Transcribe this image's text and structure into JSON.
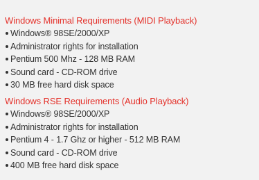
{
  "sections": [
    {
      "heading": "Windows Minimal Requirements (MIDI Playback)",
      "items": [
        "Windows® 98SE/2000/XP",
        "Administrator rights for installation",
        "Pentium 500 Mhz - 128 MB RAM",
        "Sound card - CD-ROM drive",
        "30 MB free hard disk space"
      ]
    },
    {
      "heading": "Windows RSE Requirements (Audio Playback)",
      "items": [
        "Windows® 98SE/2000/XP",
        "Administrator rights for installation",
        "Pentium 4 - 1.7 Ghz or higher - 512 MB RAM",
        "Sound card - CD-ROM drive",
        "400 MB free hard disk space"
      ]
    }
  ],
  "colors": {
    "heading": "#e4322b",
    "text": "#333333",
    "background": "#f2f2f2"
  },
  "icons": {
    "bullet": "bullet-dot-icon"
  }
}
